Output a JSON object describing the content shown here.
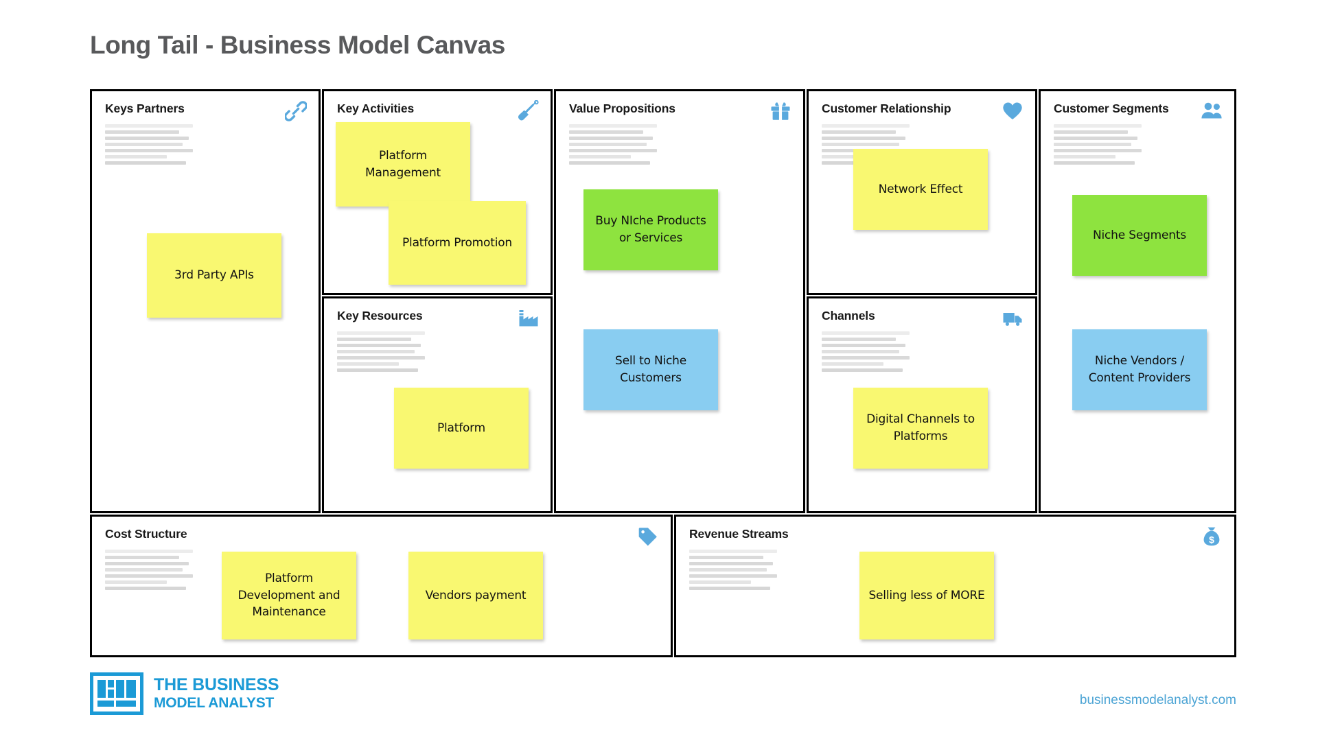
{
  "page": {
    "title": "Long Tail - Business Model Canvas",
    "background": "#ffffff",
    "title_color": "#58595b"
  },
  "colors": {
    "note_yellow": "#f9f871",
    "note_green": "#8ee33f",
    "note_blue": "#89cdf1",
    "icon_blue": "#5aa9dd",
    "logo_blue": "#1b9ad6",
    "url_blue": "#4aa3d4",
    "border": "#000000"
  },
  "blocks": [
    {
      "key": "key_partners",
      "title": "Keys Partners",
      "icon": "chain-link-icon",
      "notes": [
        {
          "text": "3rd Party APIs",
          "color": "yellow"
        }
      ]
    },
    {
      "key": "key_activities",
      "title": "Key Activities",
      "icon": "shovel-icon",
      "notes": [
        {
          "text": "Platform Management",
          "color": "yellow"
        },
        {
          "text": "Platform Promotion",
          "color": "yellow"
        }
      ]
    },
    {
      "key": "key_resources",
      "title": "Key Resources",
      "icon": "factory-icon",
      "notes": [
        {
          "text": "Platform",
          "color": "yellow"
        }
      ]
    },
    {
      "key": "value_propositions",
      "title": "Value Propositions",
      "icon": "gift-icon",
      "notes": [
        {
          "text": "Buy NIche Products or Services",
          "color": "green"
        },
        {
          "text": "Sell to Niche Customers",
          "color": "blue"
        }
      ]
    },
    {
      "key": "customer_relationship",
      "title": "Customer Relationship",
      "icon": "heart-icon",
      "notes": [
        {
          "text": "Network Effect",
          "color": "yellow"
        }
      ]
    },
    {
      "key": "channels",
      "title": "Channels",
      "icon": "truck-icon",
      "notes": [
        {
          "text": "Digital Channels to Platforms",
          "color": "yellow"
        }
      ]
    },
    {
      "key": "customer_segments",
      "title": "Customer Segments",
      "icon": "users-icon",
      "notes": [
        {
          "text": "Niche Segments",
          "color": "green"
        },
        {
          "text": "Niche Vendors / Content Providers",
          "color": "blue"
        }
      ]
    },
    {
      "key": "cost_structure",
      "title": "Cost Structure",
      "icon": "price-tag-icon",
      "notes": [
        {
          "text": "Platform Development and Maintenance",
          "color": "yellow"
        },
        {
          "text": "Vendors payment",
          "color": "yellow"
        }
      ]
    },
    {
      "key": "revenue_streams",
      "title": "Revenue Streams",
      "icon": "money-bag-icon",
      "notes": [
        {
          "text": "Selling less of MORE",
          "color": "yellow"
        }
      ]
    }
  ],
  "footer": {
    "logo_line1": "THE BUSINESS",
    "logo_line2": "MODEL ANALYST",
    "logo_icon": "canvas-grid-logo-icon",
    "url": "businessmodelanalyst.com"
  }
}
